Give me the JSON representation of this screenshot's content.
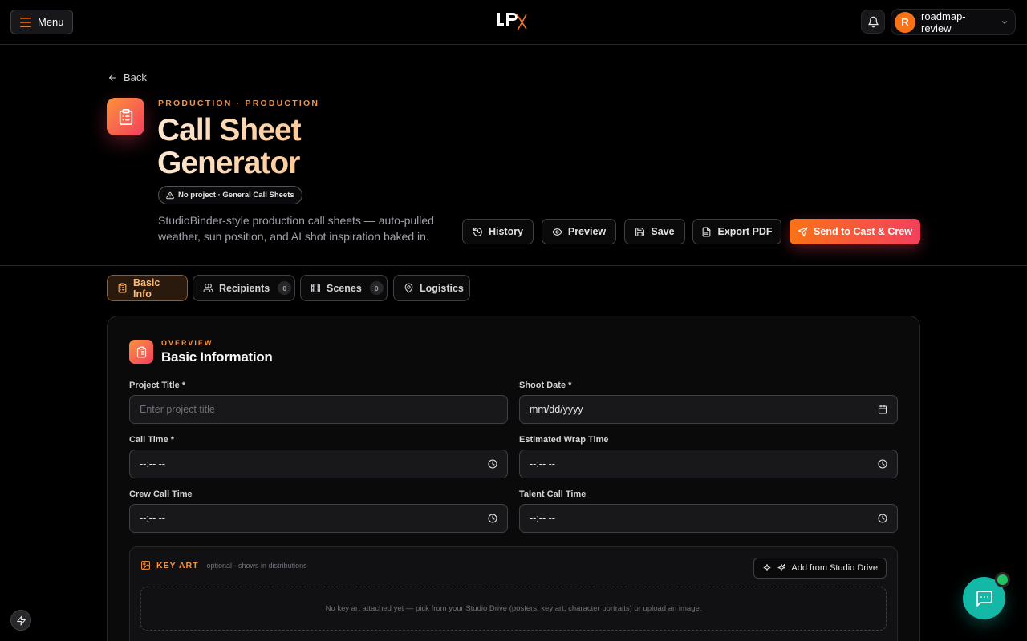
{
  "topbar": {
    "menu_label": "Menu",
    "user_initial": "R",
    "user_name": "roadmap-review"
  },
  "header": {
    "back_label": "Back",
    "eyebrow": "PRODUCTION · PRODUCTION",
    "title_line1": "Call Sheet",
    "title_line2": "Generator",
    "project_badge": "No project · General Call Sheets",
    "description": "StudioBinder-style production call sheets — auto-pulled weather, sun position, and AI shot inspiration baked in."
  },
  "actions": {
    "history": "History",
    "preview": "Preview",
    "save": "Save",
    "export": "Export PDF",
    "send": "Send to Cast & Crew"
  },
  "tabs": [
    {
      "label": "Basic Info",
      "count": null
    },
    {
      "label": "Recipients",
      "count": "0"
    },
    {
      "label": "Scenes",
      "count": "0"
    },
    {
      "label": "Logistics",
      "count": null
    }
  ],
  "card": {
    "eyebrow": "OVERVIEW",
    "title": "Basic Information",
    "fields": {
      "project_title": {
        "label": "Project Title *",
        "placeholder": "Enter project title"
      },
      "shoot_date": {
        "label": "Shoot Date *",
        "value": "mm/dd/yyyy"
      },
      "call_time": {
        "label": "Call Time *",
        "value": "--:-- --"
      },
      "wrap_time": {
        "label": "Estimated Wrap Time",
        "value": "--:-- --"
      },
      "crew_call": {
        "label": "Crew Call Time",
        "value": "--:-- --"
      },
      "talent_call": {
        "label": "Talent Call Time",
        "value": "--:-- --"
      }
    },
    "key_art": {
      "title": "KEY ART",
      "note": "optional · shows in distributions",
      "button": "Add from Studio Drive",
      "empty": "No key art attached yet — pick from your Studio Drive (posters, key art, character portraits) or upload an image."
    }
  },
  "colors": {
    "accent": "#f97316",
    "accent_pink": "#f43f5e",
    "chat": "#14b8a6"
  }
}
